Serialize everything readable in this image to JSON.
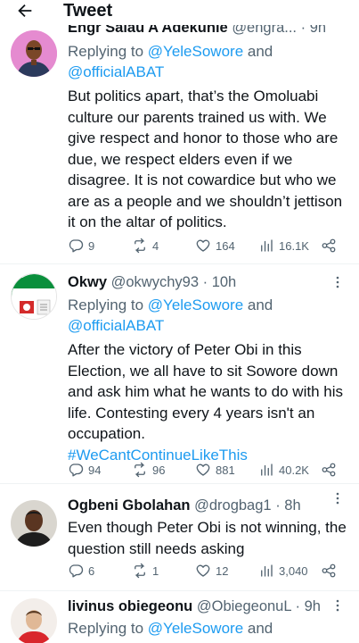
{
  "header": {
    "title": "Tweet",
    "back_icon": "arrow-left-icon"
  },
  "colors": {
    "link": "#1d9bf0",
    "muted": "#536471",
    "text": "#0f1419"
  },
  "tweets": [
    {
      "name": "Engr Salau A Adekunle",
      "handle": "@engra...",
      "time": "9h",
      "reply_prefix": "Replying to ",
      "mention1": "@YeleSowore",
      "reply_and": " and",
      "mention2": "@officialABAT",
      "text": "But politics apart, that’s the Omoluabi culture our parents trained us with. We give respect and honor to those who are due, we respect elders even if we disagree. It is not cowardice but who we are as a people and we shouldn’t jettison it on the altar of politics.",
      "replies": "9",
      "retweets": "4",
      "likes": "164",
      "views": "16.1K"
    },
    {
      "name": "Okwy",
      "handle": "@okwychy93",
      "time": "10h",
      "reply_prefix": "Replying to ",
      "mention1": "@YeleSowore",
      "reply_and": " and",
      "mention2": "@officialABAT",
      "text": "After the victory of Peter Obi in this Election, we all have to sit Sowore down and ask him what he wants to do with his life. Contesting every 4 years isn't an occupation.",
      "hashtag": "#WeCantContinueLikeThis",
      "avatar_text": "PETER OBI",
      "replies": "94",
      "retweets": "96",
      "likes": "881",
      "views": "40.2K"
    },
    {
      "name": "Ogbeni Gbolahan",
      "handle": "@drogbag1",
      "time": "8h",
      "text": "Even though Peter Obi is not winning, the question still needs asking",
      "replies": "6",
      "retweets": "1",
      "likes": "12",
      "views": "3,040"
    },
    {
      "name": "livinus obiegeonu",
      "handle": "@ObiegeonuL",
      "time": "9h",
      "reply_prefix": "Replying to ",
      "mention1": "@YeleSowore",
      "reply_and": " and"
    }
  ]
}
